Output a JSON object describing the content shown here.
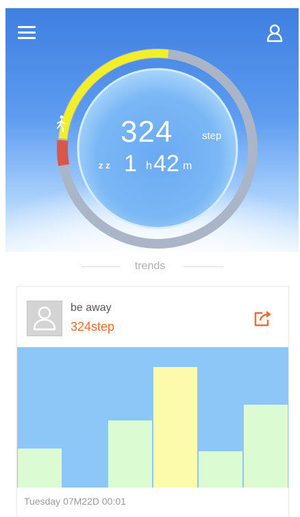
{
  "header": {
    "menu_icon": "menu-icon",
    "profile_icon": "profile-icon"
  },
  "activity": {
    "steps": "324",
    "steps_unit": "step",
    "sleep_hours": "1",
    "sleep_hours_unit": "h",
    "sleep_minutes": "42",
    "sleep_minutes_unit": "m",
    "walk_icon": "walking-person-icon",
    "sleep_icon": "sleep-zz-icon",
    "sleep_icon_glyph": "z z",
    "ring_progress_fraction": 0.14,
    "ring_colors": {
      "track": "#aab6c8",
      "progress": "#f0ef2a",
      "marker": "#d9564a"
    }
  },
  "trends": {
    "label": "trends"
  },
  "card": {
    "name": "be away",
    "steps_text": "324step",
    "share_icon": "share-icon",
    "timestamp": "Tuesday 07M22D 00:01",
    "accent_color": "#f06b2c",
    "chart_data": {
      "type": "bar",
      "values": [
        0.28,
        0.0,
        0.48,
        0.86,
        0.26,
        0.59
      ],
      "colors": [
        "#dbfcd3",
        "#8cc7f7",
        "#dbfcd3",
        "#fbfbab",
        "#dbfcd3",
        "#dbfcd3"
      ],
      "background": "#8cc7f7"
    }
  }
}
